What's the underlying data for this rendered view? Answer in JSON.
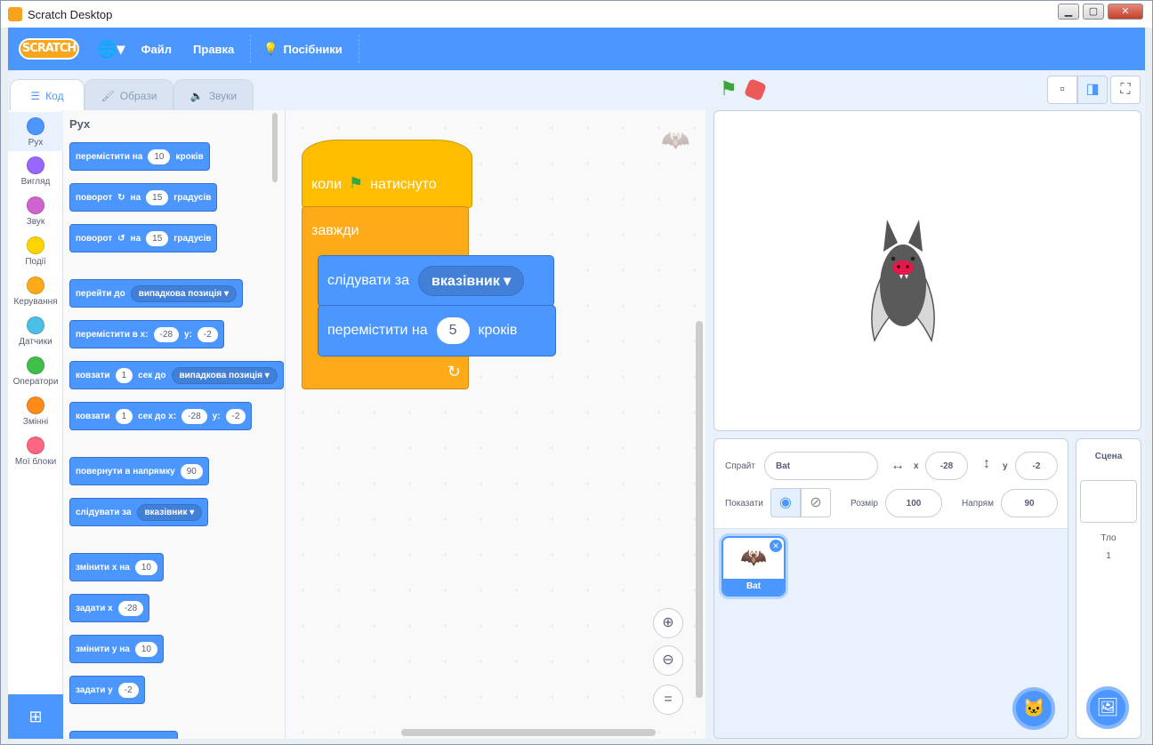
{
  "window": {
    "title": "Scratch Desktop"
  },
  "menu": {
    "logo": "SCRATCH",
    "file": "Файл",
    "edit": "Правка",
    "tutorials": "Посібники"
  },
  "tabs": [
    {
      "label": "Код"
    },
    {
      "label": "Образи"
    },
    {
      "label": "Звуки"
    }
  ],
  "categories": [
    {
      "label": "Рух",
      "color": "#4c97ff"
    },
    {
      "label": "Вигляд",
      "color": "#9966ff"
    },
    {
      "label": "Звук",
      "color": "#cf63cf"
    },
    {
      "label": "Події",
      "color": "#ffd500"
    },
    {
      "label": "Керування",
      "color": "#ffab19"
    },
    {
      "label": "Датчики",
      "color": "#4cbfe6"
    },
    {
      "label": "Оператори",
      "color": "#40bf4a"
    },
    {
      "label": "Змінні",
      "color": "#ff8c1a"
    },
    {
      "label": "Мої блоки",
      "color": "#ff6680"
    }
  ],
  "palette": {
    "heading": "Рух",
    "move": {
      "pre": "перемістити на",
      "val": "10",
      "post": "кроків"
    },
    "turn_right": {
      "pre": "поворот",
      "icon": "rotate-right-icon",
      "mid": "на",
      "val": "15",
      "post": "градусів"
    },
    "turn_left": {
      "pre": "поворот",
      "icon": "rotate-left-icon",
      "mid": "на",
      "val": "15",
      "post": "градусів"
    },
    "goto": {
      "pre": "перейти до",
      "dd": "випадкова позиція"
    },
    "goto_xy": {
      "pre": "перемістити в x:",
      "x": "-28",
      "ylab": "y:",
      "y": "-2"
    },
    "glide": {
      "pre": "ковзати",
      "val": "1",
      "mid": "сек до",
      "dd": "випадкова позиція"
    },
    "glide_xy": {
      "pre": "ковзати",
      "val": "1",
      "mid": "сек до x:",
      "x": "-28",
      "ylab": "y:",
      "y": "-2"
    },
    "point_dir": {
      "pre": "повернути в напрямку",
      "val": "90"
    },
    "point_towards": {
      "pre": "слідувати за",
      "dd": "вказівник"
    },
    "change_x": {
      "pre": "змінити x на",
      "val": "10"
    },
    "set_x": {
      "pre": "задати x",
      "val": "-28"
    },
    "change_y": {
      "pre": "змінити y на",
      "val": "10"
    },
    "set_y": {
      "pre": "задати y",
      "val": "-2"
    }
  },
  "script": {
    "hat": {
      "pre": "коли",
      "icon": "green-flag-icon",
      "post": "натиснуто"
    },
    "forever": "завжди",
    "follow": {
      "pre": "слідувати за",
      "dd": "вказівник"
    },
    "move": {
      "pre": "перемістити на",
      "val": "5",
      "post": "кроків"
    }
  },
  "sprite": {
    "label": "Спрайт",
    "name": "Bat",
    "x_label": "x",
    "x": "-28",
    "y_label": "y",
    "y": "-2",
    "show_label": "Показати",
    "size_label": "Розмір",
    "size": "100",
    "dir_label": "Напрям",
    "dir": "90",
    "thumb_name": "Bat"
  },
  "stage_panel": {
    "title": "Сцена",
    "backdrops_label": "Тло",
    "backdrops_count": "1"
  },
  "colors": {
    "accent": "#4c97ff",
    "menubar": "#4c97ff",
    "events": "#ffbf00",
    "control": "#ffab19"
  }
}
